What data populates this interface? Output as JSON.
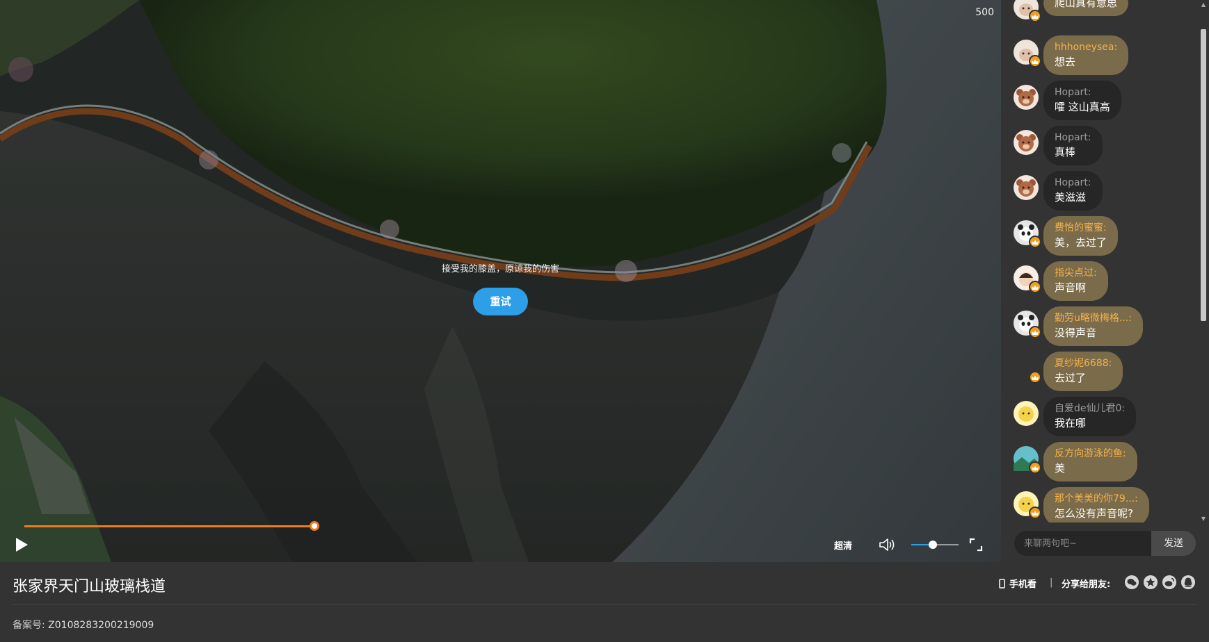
{
  "player": {
    "counter": "500",
    "error_message": "接受我的膝盖，原谅我的伤害",
    "retry_label": "重试",
    "progress": 1.0,
    "quality_label": "超清",
    "volume": 0.46,
    "accent_color": "#f07c1c"
  },
  "chat": {
    "messages": [
      {
        "name": "",
        "text": "爬山真有意思",
        "vip": true,
        "avatar": "cat-avatar"
      },
      {
        "name": "hhhoneysea:",
        "text": "想去",
        "vip": true,
        "avatar": "cat-avatar"
      },
      {
        "name": "Hopart:",
        "text": "嚯 这山真高",
        "vip": false,
        "avatar": "bear-avatar"
      },
      {
        "name": "Hopart:",
        "text": "真棒",
        "vip": false,
        "avatar": "bear-avatar"
      },
      {
        "name": "Hopart:",
        "text": "美滋滋",
        "vip": false,
        "avatar": "bear-avatar"
      },
      {
        "name": "费怡的蜜蜜:",
        "text": "美，去过了",
        "vip": true,
        "avatar": "panda-avatar"
      },
      {
        "name": "指尖点过:",
        "text": "声音啊",
        "vip": true,
        "avatar": "girl-avatar"
      },
      {
        "name": "勤劳u略微梅格...:",
        "text": "没得声音",
        "vip": true,
        "avatar": "panda-avatar"
      },
      {
        "name": "夏纱妮6688:",
        "text": "去过了",
        "vip": true,
        "avatar": "none"
      },
      {
        "name": "自爱de仙儿君0:",
        "text": "我在哪",
        "vip": false,
        "avatar": "yellow-avatar"
      },
      {
        "name": "反方向游泳的鱼:",
        "text": "美",
        "vip": true,
        "avatar": "landscape-avatar"
      },
      {
        "name": "那个美美的你79...:",
        "text": "怎么没有声音呢?",
        "vip": true,
        "avatar": "yellow-avatar"
      }
    ],
    "input_placeholder": "来聊两句吧~",
    "send_label": "发送"
  },
  "info": {
    "title": "张家界天门山玻璃栈道",
    "record_label": "备案号:",
    "record_number": "Z0108283200219009",
    "mobile_watch": "手机看",
    "separator": "|",
    "share_label": "分享给朋友:",
    "share_icons": [
      "wechat-icon",
      "qzone-icon",
      "weibo-icon",
      "qq-icon"
    ]
  }
}
